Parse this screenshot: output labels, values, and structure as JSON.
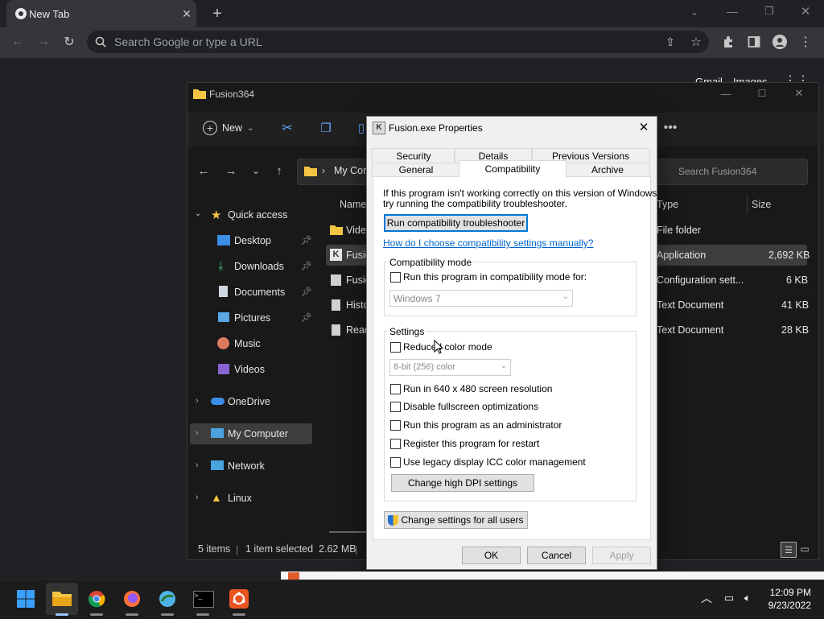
{
  "browser": {
    "tab_title": "New Tab",
    "omnibox_placeholder": "Search Google or type a URL",
    "ntp_links": [
      "Gmail",
      "Images"
    ]
  },
  "explorer": {
    "title": "Fusion364",
    "new_label": "New",
    "address_crumb": "My Com",
    "search_placeholder": "Search Fusion364",
    "columns": {
      "name": "Name",
      "type": "Type",
      "size": "Size"
    },
    "sidebar": {
      "quick_access": "Quick access",
      "items": [
        {
          "label": "Desktop",
          "pinned": true
        },
        {
          "label": "Downloads",
          "pinned": true
        },
        {
          "label": "Documents",
          "pinned": true
        },
        {
          "label": "Pictures",
          "pinned": true
        },
        {
          "label": "Music",
          "pinned": false
        },
        {
          "label": "Videos",
          "pinned": false
        }
      ],
      "onedrive": "OneDrive",
      "my_computer": "My Computer",
      "network": "Network",
      "linux": "Linux"
    },
    "files": [
      {
        "name": "Vide",
        "type": "File folder",
        "size": ""
      },
      {
        "name": "Fusio",
        "type": "Application",
        "size": "2,692 KB"
      },
      {
        "name": "Fusio",
        "type": "Configuration sett...",
        "size": "6 KB"
      },
      {
        "name": "Histo",
        "type": "Text Document",
        "size": "41 KB"
      },
      {
        "name": "Read",
        "type": "Text Document",
        "size": "28 KB"
      }
    ],
    "status": {
      "items": "5 items",
      "selected": "1 item selected  2.62 MB"
    }
  },
  "dialog": {
    "title": "Fusion.exe Properties",
    "tabs_row1": [
      "Security",
      "Details",
      "Previous Versions"
    ],
    "tabs_row2": [
      "General",
      "Compatibility",
      "Archive"
    ],
    "intro_line1": "If this program isn't working correctly on this version of Windows,",
    "intro_line2": "try running the compatibility troubleshooter.",
    "troubleshooter_button": "Run compatibility troubleshooter",
    "help_link": "How do I choose compatibility settings manually?",
    "compat_group": "Compatibility mode",
    "compat_checkbox": "Run this program in compatibility mode for:",
    "compat_os": "Windows 7",
    "settings_group": "Settings",
    "reduced_color": "Reduced color mode",
    "color_option": "8-bit (256) color",
    "options": [
      "Run in 640 x 480 screen resolution",
      "Disable fullscreen optimizations",
      "Run this program as an administrator",
      "Register this program for restart",
      "Use legacy display ICC color management"
    ],
    "dpi_button": "Change high DPI settings",
    "all_users_button": "Change settings for all users",
    "ok": "OK",
    "cancel": "Cancel",
    "apply": "Apply"
  },
  "taskbar": {
    "time": "12:09 PM",
    "date": "9/23/2022"
  }
}
